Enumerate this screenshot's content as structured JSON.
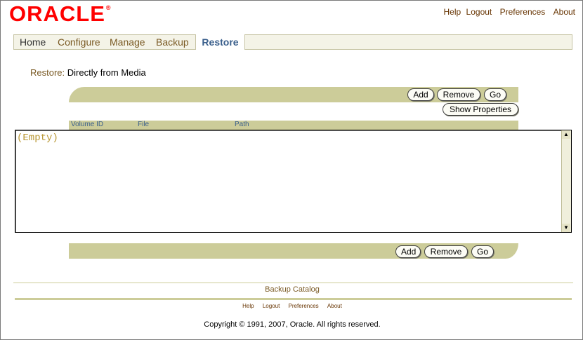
{
  "brand": {
    "logo_text": "ORACLE",
    "reg_mark": "®",
    "color": "#ff0000"
  },
  "global_links": {
    "help": "Help",
    "logout": "Logout",
    "preferences": "Preferences",
    "about": "About"
  },
  "tabs": [
    {
      "label": "Home"
    },
    {
      "label": "Configure"
    },
    {
      "label": "Manage"
    },
    {
      "label": "Backup"
    },
    {
      "label": "Restore",
      "selected": true
    }
  ],
  "breadcrumb": {
    "label": "Restore:",
    "value": "Directly from Media"
  },
  "toolbar_top": {
    "add": "Add",
    "remove": "Remove",
    "go": "Go",
    "show_properties": "Show Properties"
  },
  "table": {
    "columns": [
      "Volume ID",
      "File",
      "Path"
    ],
    "empty_text": "(Empty)"
  },
  "toolbar_bottom": {
    "add": "Add",
    "remove": "Remove",
    "go": "Go"
  },
  "footer": {
    "catalog_link": "Backup Catalog",
    "links": {
      "help": "Help",
      "logout": "Logout",
      "preferences": "Preferences",
      "about": "About"
    },
    "copyright": "Copyright © 1991, 2007, Oracle. All rights reserved."
  },
  "colors": {
    "accent_bar": "#cccc99",
    "tab_active": "#3a5f8c",
    "link": "#663300"
  },
  "icons": {
    "scroll_up": "scroll-up-icon",
    "scroll_down": "scroll-down-icon"
  }
}
